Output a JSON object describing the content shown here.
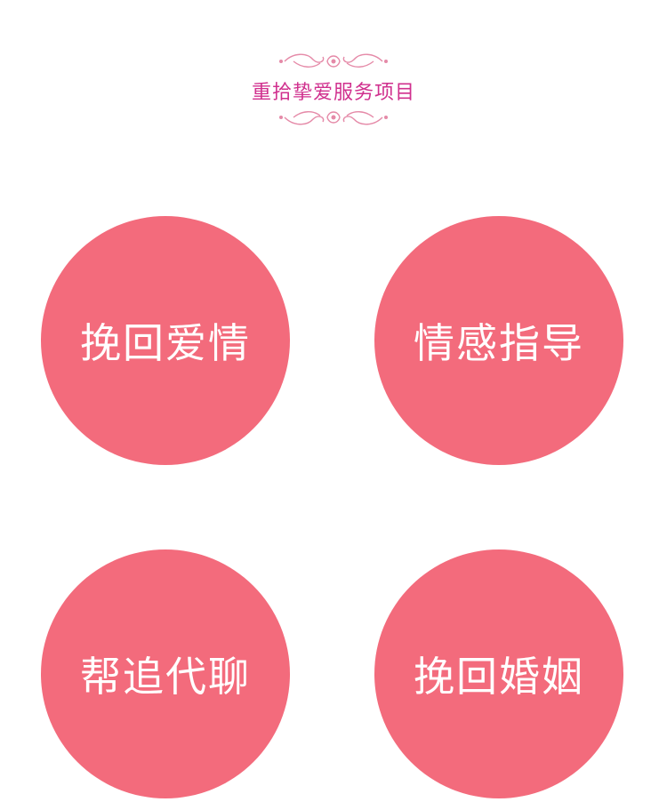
{
  "header": {
    "title": "重拾挚爱服务项目",
    "accent": "#d0308e",
    "ornament_color": "#e58aa8"
  },
  "services": [
    {
      "label": "挽回爱情"
    },
    {
      "label": "情感指导"
    },
    {
      "label": "帮追代聊"
    },
    {
      "label": "挽回婚姻"
    }
  ],
  "colors": {
    "circle": "#f36b7c",
    "text": "#ffffff"
  }
}
